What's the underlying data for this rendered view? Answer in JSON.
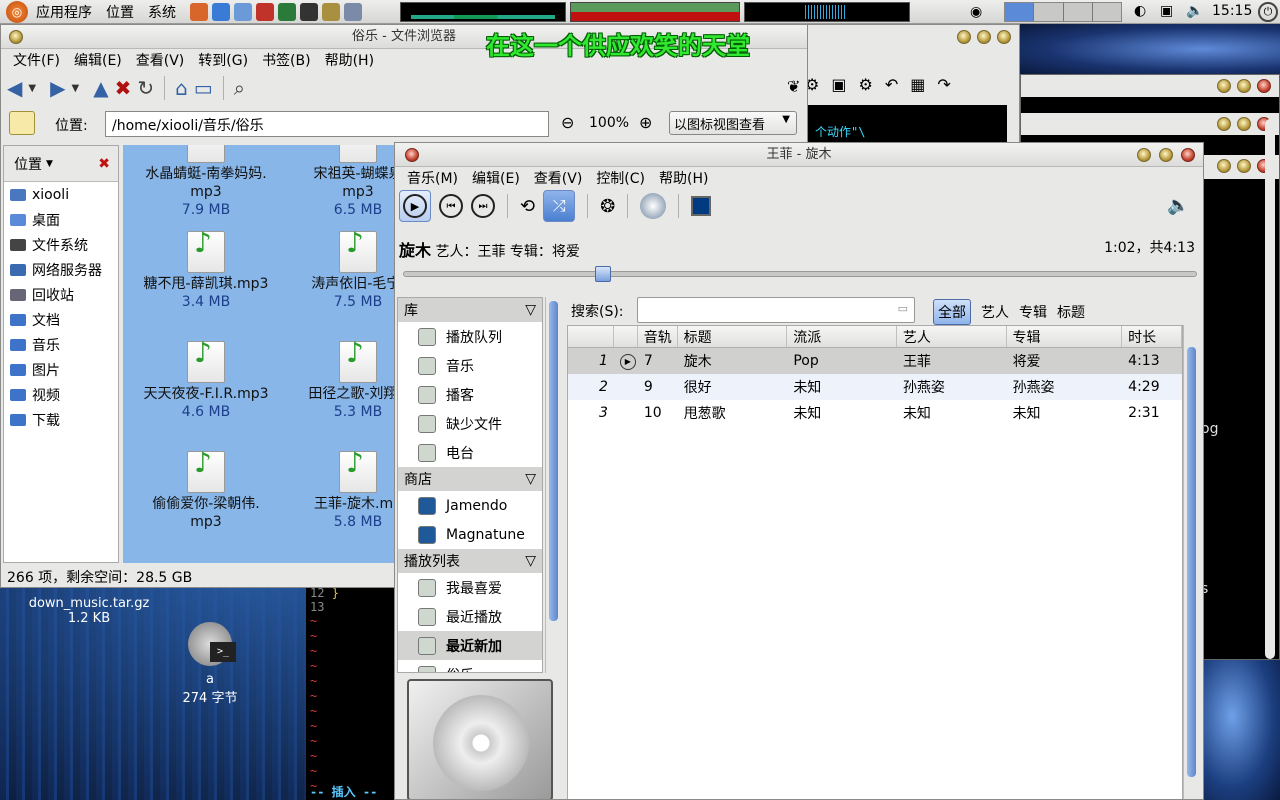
{
  "topbar": {
    "menus": [
      "应用程序",
      "位置",
      "系统"
    ],
    "clock": "15:15"
  },
  "desktop": {
    "overlay_text": "在这一个供应欢笑的天堂",
    "files": [
      {
        "name": "down_music.tar.gz",
        "size": "1.2 KB"
      },
      {
        "name": "a",
        "size": "274 字节"
      }
    ]
  },
  "file_browser": {
    "title": "俗乐 - 文件浏览器",
    "menus": [
      "文件(F)",
      "编辑(E)",
      "查看(V)",
      "转到(G)",
      "书签(B)",
      "帮助(H)"
    ],
    "location_label": "位置:",
    "location_value": "/home/xiooli/音乐/俗乐",
    "zoom": "100%",
    "view_mode": "以图标视图查看",
    "side_header": "位置",
    "places": [
      "xiooli",
      "桌面",
      "文件系统",
      "网络服务器",
      "回收站",
      "文档",
      "音乐",
      "图片",
      "视频",
      "下载"
    ],
    "items": [
      {
        "name": "水晶蜻蜓-南拳妈妈.",
        "ext": "mp3",
        "size": "7.9 MB"
      },
      {
        "name": "宋祖英-蝴蝶泉",
        "ext": "mp3",
        "size": "6.5 MB"
      },
      {
        "name": "糖不甩-薛凯琪.mp3",
        "ext": "",
        "size": "3.4 MB"
      },
      {
        "name": "涛声依旧-毛宁.",
        "ext": "",
        "size": "7.5 MB"
      },
      {
        "name": "天天夜夜-F.I.R.mp3",
        "ext": "",
        "size": "4.6 MB"
      },
      {
        "name": "田径之歌-刘翔.r",
        "ext": "",
        "size": "5.3 MB"
      },
      {
        "name": "偷偷爱你-梁朝伟.",
        "ext": "mp3",
        "size": ""
      },
      {
        "name": "王菲-旋木.mp",
        "ext": "",
        "size": "5.8 MB"
      }
    ],
    "status": "266 项，剩余空间：28.5 GB"
  },
  "terminal": {
    "line_numbers": [
      "12",
      "13"
    ],
    "brace": "}",
    "tilde": "~",
    "mode": "-- 插入 --",
    "fragment": "个动作\"\\"
  },
  "player": {
    "title": "王菲 - 旋木",
    "menus": [
      "音乐(M)",
      "编辑(E)",
      "查看(V)",
      "控制(C)",
      "帮助(H)"
    ],
    "now_title": "旋木",
    "artist_label": "艺人：",
    "artist": "王菲",
    "album_label": "专辑：",
    "album": "将爱",
    "time": "1:02，共4:13",
    "progress": 0.25,
    "search_label": "搜索(S):",
    "filters": [
      "全部",
      "艺人",
      "专辑",
      "标题"
    ],
    "sections": {
      "library": "库",
      "store": "商店",
      "playlists": "播放列表"
    },
    "library_items": [
      "播放队列",
      "音乐",
      "播客",
      "缺少文件",
      "电台"
    ],
    "store_items": [
      "Jamendo",
      "Magnatune"
    ],
    "playlist_items": [
      "我最喜爱",
      "最近播放",
      "最近新加",
      "俗乐"
    ],
    "columns": [
      "音轨",
      "标题",
      "流派",
      "艺人",
      "专辑",
      "时长"
    ],
    "rows": [
      {
        "n": "1",
        "track": "7",
        "title": "旋木",
        "genre": "Pop",
        "artist": "王菲",
        "album": "将爱",
        "dur": "4:13"
      },
      {
        "n": "2",
        "track": "9",
        "title": "很好",
        "genre": "未知",
        "artist": "孙燕姿",
        "album": "孙燕姿",
        "dur": "4:29"
      },
      {
        "n": "3",
        "track": "10",
        "title": "甩葱歌",
        "genre": "未知",
        "artist": "未知",
        "album": "未知",
        "dur": "2:31"
      }
    ]
  },
  "right_fragments": [
    "og",
    "s"
  ]
}
